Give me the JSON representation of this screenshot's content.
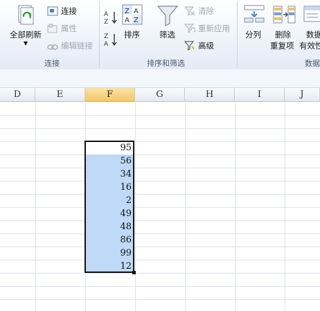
{
  "ribbon": {
    "refresh_all": "全部刷新",
    "connections_items": [
      "连接",
      "属性",
      "编辑链接"
    ],
    "sort": "排序",
    "filter": "筛选",
    "filter_items": [
      "清除",
      "重新应用",
      "高级"
    ],
    "split_column": "分列",
    "remove_dup": [
      "删除",
      "重复项"
    ],
    "data_valid": [
      "数据",
      "有效性"
    ],
    "groups": [
      "连接",
      "排序和筛选",
      "数据"
    ]
  },
  "sheet": {
    "columns": [
      "D",
      "E",
      "F",
      "G",
      "H",
      "I",
      "J"
    ],
    "values": [
      "95",
      "56",
      "34",
      "16",
      "2",
      "49",
      "48",
      "86",
      "99",
      "12"
    ]
  }
}
